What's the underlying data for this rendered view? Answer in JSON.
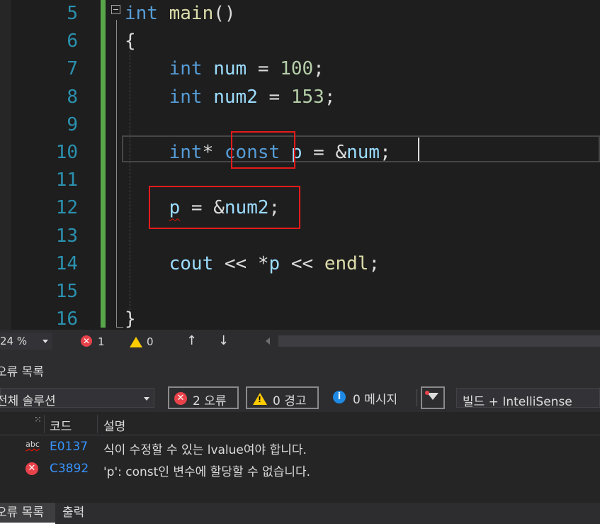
{
  "editor": {
    "line_numbers": [
      "5",
      "6",
      "7",
      "8",
      "9",
      "10",
      "11",
      "12",
      "13",
      "14",
      "15",
      "16"
    ],
    "lines": [
      [
        {
          "t": "int",
          "c": "kw"
        },
        {
          "t": " ",
          "c": "op"
        },
        {
          "t": "main",
          "c": "fn"
        },
        {
          "t": "()",
          "c": "op"
        }
      ],
      [
        {
          "t": "{",
          "c": "op"
        }
      ],
      [
        {
          "t": "    ",
          "c": "op"
        },
        {
          "t": "int",
          "c": "kw"
        },
        {
          "t": " ",
          "c": "op"
        },
        {
          "t": "num",
          "c": "var"
        },
        {
          "t": " = ",
          "c": "op"
        },
        {
          "t": "100",
          "c": "num"
        },
        {
          "t": ";",
          "c": "op"
        }
      ],
      [
        {
          "t": "    ",
          "c": "op"
        },
        {
          "t": "int",
          "c": "kw"
        },
        {
          "t": " ",
          "c": "op"
        },
        {
          "t": "num2",
          "c": "var"
        },
        {
          "t": " = ",
          "c": "op"
        },
        {
          "t": "153",
          "c": "num"
        },
        {
          "t": ";",
          "c": "op"
        }
      ],
      [],
      [
        {
          "t": "    ",
          "c": "op"
        },
        {
          "t": "int",
          "c": "kw"
        },
        {
          "t": "* ",
          "c": "op"
        },
        {
          "t": "const",
          "c": "kw"
        },
        {
          "t": " ",
          "c": "op"
        },
        {
          "t": "p",
          "c": "var"
        },
        {
          "t": " = &",
          "c": "op"
        },
        {
          "t": "num",
          "c": "var"
        },
        {
          "t": ";",
          "c": "op"
        }
      ],
      [],
      [
        {
          "t": "    ",
          "c": "op"
        },
        {
          "t": "p",
          "c": "var squiggle"
        },
        {
          "t": " = &",
          "c": "op"
        },
        {
          "t": "num2",
          "c": "var"
        },
        {
          "t": ";",
          "c": "op"
        }
      ],
      [],
      [
        {
          "t": "    ",
          "c": "op"
        },
        {
          "t": "cout",
          "c": "var"
        },
        {
          "t": " << *",
          "c": "op"
        },
        {
          "t": "p",
          "c": "var"
        },
        {
          "t": " << ",
          "c": "op"
        },
        {
          "t": "endl",
          "c": "fn"
        },
        {
          "t": ";",
          "c": "op"
        }
      ],
      [],
      [
        {
          "t": "}",
          "c": "op"
        }
      ]
    ]
  },
  "status_strip": {
    "zoom": "24 %",
    "error_count": "1",
    "warning_count": "0",
    "up_arrow": "↑",
    "down_arrow": "↓"
  },
  "error_list": {
    "title": "오류 목록",
    "scope": "전체 솔루션",
    "errors_button": "2 오류",
    "warnings_button": "0 경고",
    "messages_button": "0 메시지",
    "source": "빌드 + IntelliSense",
    "columns": {
      "code": "코드",
      "description": "설명"
    },
    "rows": [
      {
        "icon": "abc-squiggle-icon",
        "icon_text": "abc",
        "code": "E0137",
        "description": "식이 수정할 수 있는 lvalue여야 합니다."
      },
      {
        "icon": "error-icon",
        "code": "C3892",
        "description": "'p': const인 변수에 할당할 수 없습니다."
      }
    ]
  },
  "bottom_tabs": {
    "error_list": "오류 목록",
    "output": "출력"
  },
  "colors": {
    "keyword": "#569cd6",
    "function": "#dcdcaa",
    "variable": "#9cdcfe",
    "number": "#b5cea8",
    "line_number": "#2b91af",
    "change_bar": "#57a64a",
    "annotation_box": "#e31b1b",
    "error": "#e8424a",
    "warning": "#ffcc00",
    "info": "#1e8ae6"
  }
}
